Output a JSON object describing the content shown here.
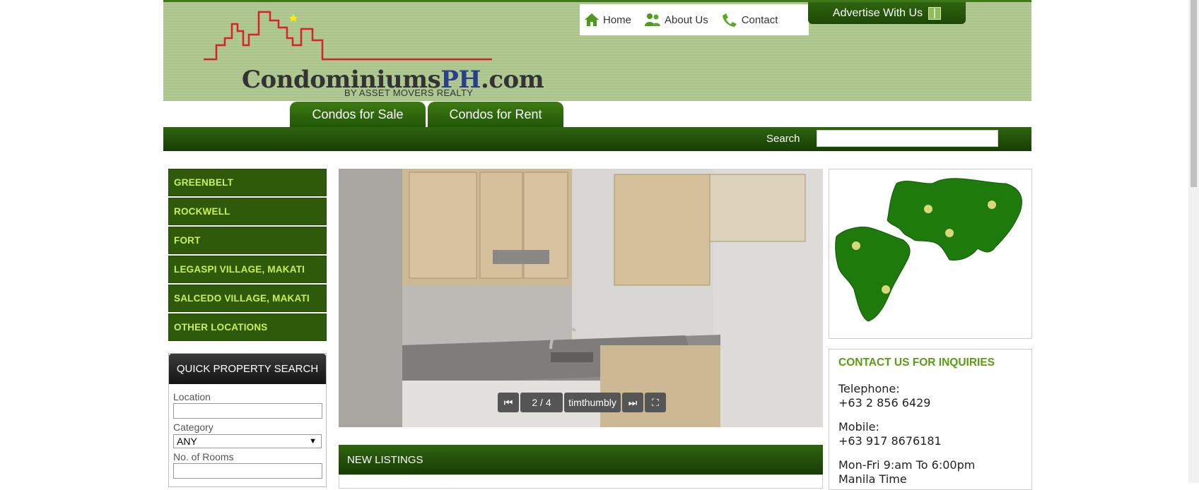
{
  "header": {
    "logo_main": "Condominiums",
    "logo_ph": "PH",
    "logo_com": ".com",
    "logo_sub": "BY ASSET MOVERS REALTY",
    "nav": [
      {
        "label": "Home",
        "icon": "home-icon"
      },
      {
        "label": "About Us",
        "icon": "users-icon"
      },
      {
        "label": "Contact",
        "icon": "phone-icon"
      }
    ],
    "advertise": "Advertise With Us"
  },
  "tabs": [
    "Condos for Sale",
    "Condos for Rent"
  ],
  "search": {
    "label": "Search",
    "value": ""
  },
  "sidebar": {
    "locations": [
      "GREENBELT",
      "ROCKWELL",
      "FORT",
      "LEGASPI VILLAGE, MAKATI",
      "SALCEDO VILLAGE, MAKATI",
      "OTHER LOCATIONS"
    ]
  },
  "quick_search": {
    "title": "QUICK PROPERTY SEARCH",
    "location_label": "Location",
    "category_label": "Category",
    "category_value": "ANY",
    "rooms_label": "No. of Rooms"
  },
  "slideshow": {
    "counter": "2 / 4",
    "caption": "timthumbly"
  },
  "new_listings": {
    "title": "NEW LISTINGS"
  },
  "contact": {
    "title": "CONTACT US FOR INQUIRIES",
    "telephone_label": "Telephone:",
    "telephone": "+63 2 856 6429",
    "mobile_label": "Mobile:",
    "mobile": "+63 917 8676181",
    "hours": "Mon-Fri 9:am To 6:00pm",
    "timezone": "Manila Time"
  },
  "colors": {
    "brand_green": "#2f6410",
    "header_bg": "#a9c38a",
    "accent_lime": "#c8f05a"
  }
}
